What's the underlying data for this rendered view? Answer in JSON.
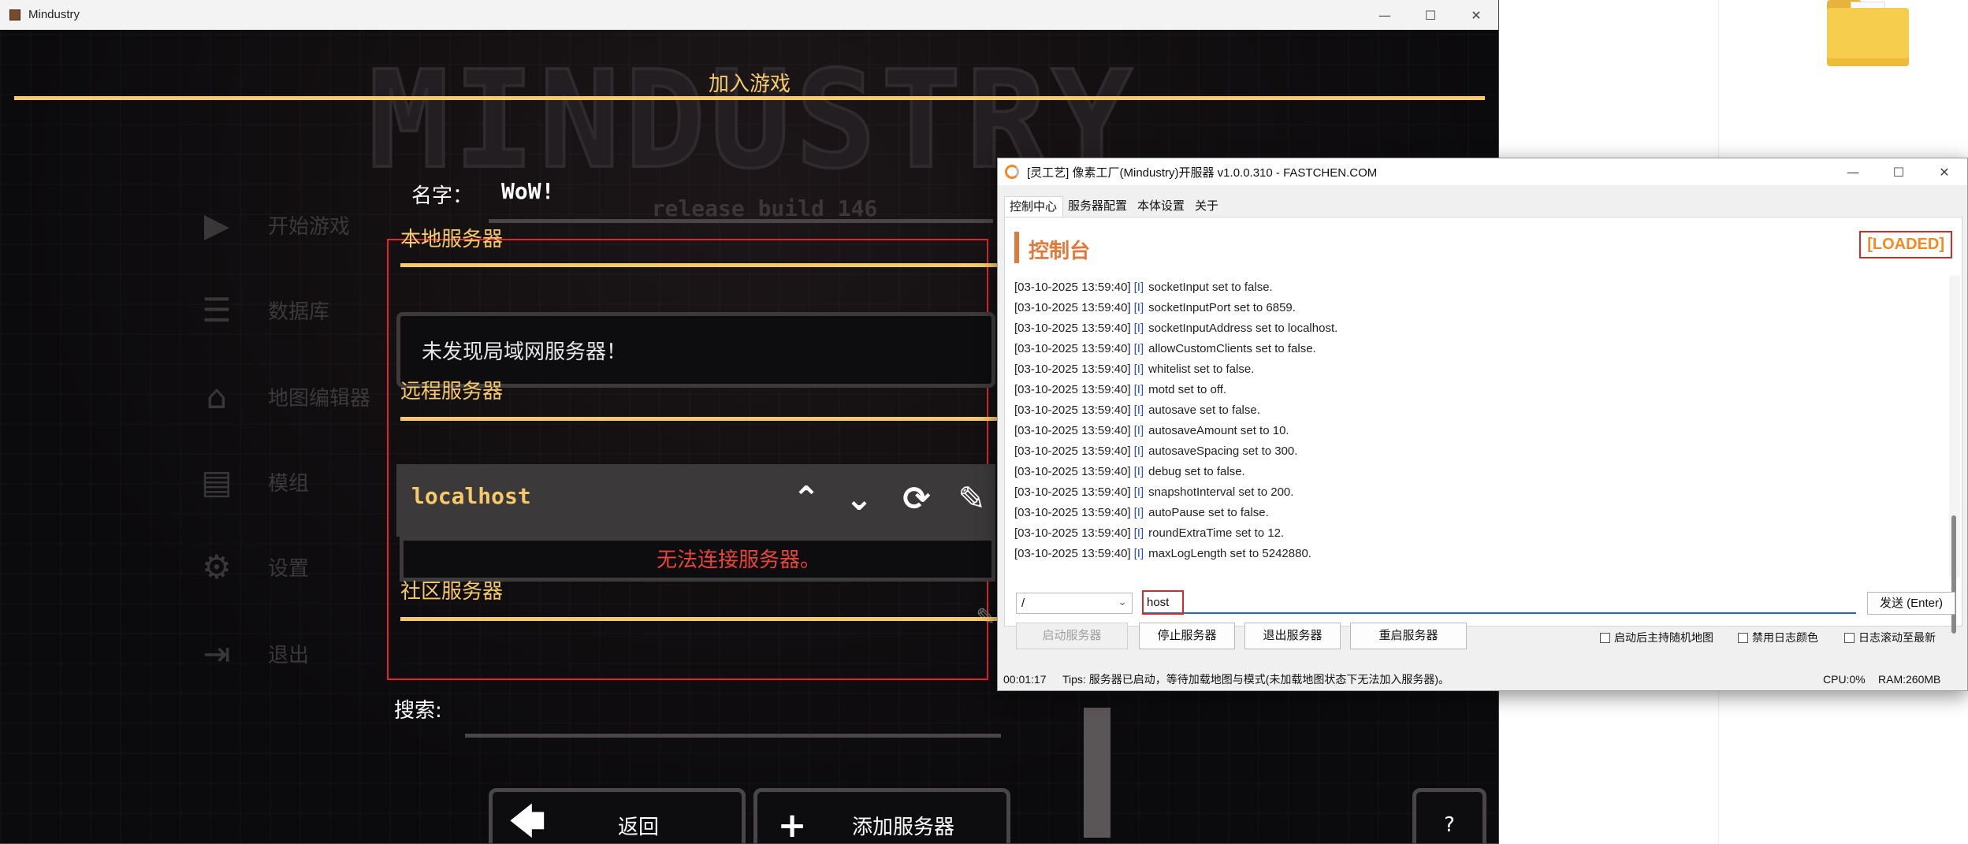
{
  "mindustry": {
    "window_title": "Mindustry",
    "logo_text": "MINDUSTRY",
    "build": "release build 146",
    "page_title": "加入游戏",
    "name_label": "名字：",
    "name_value": "WoW!",
    "menu": [
      "开始游戏",
      "数据库",
      "地图编辑器",
      "模组",
      "设置",
      "退出"
    ],
    "local_title": "本地服务器",
    "local_empty": "未发现局域网服务器！",
    "remote_title": "远程服务器",
    "server_name": "localhost",
    "server_error": "无法连接服务器。",
    "community_title": "社区服务器",
    "search_label": "搜索:",
    "back_label": "返回",
    "add_server_label": "添加服务器",
    "help_label": "?"
  },
  "console": {
    "window_title": "[灵工艺] 像素工厂(Mindustry)开服器 v1.0.0.310 - FASTCHEN.COM",
    "tabs": [
      "控制中心",
      "服务器配置",
      "本体设置",
      "关于"
    ],
    "header": "控制台",
    "status_badge": "[LOADED]",
    "log": [
      {
        "ts": "[03-10-2025 13:59:40]",
        "lv": "[I]",
        "msg": "socketInput set to false."
      },
      {
        "ts": "[03-10-2025 13:59:40]",
        "lv": "[I]",
        "msg": "socketInputPort set to 6859."
      },
      {
        "ts": "[03-10-2025 13:59:40]",
        "lv": "[I]",
        "msg": "socketInputAddress set to localhost."
      },
      {
        "ts": "[03-10-2025 13:59:40]",
        "lv": "[I]",
        "msg": "allowCustomClients set to false."
      },
      {
        "ts": "[03-10-2025 13:59:40]",
        "lv": "[I]",
        "msg": "whitelist set to false."
      },
      {
        "ts": "[03-10-2025 13:59:40]",
        "lv": "[I]",
        "msg": "motd set to off."
      },
      {
        "ts": "[03-10-2025 13:59:40]",
        "lv": "[I]",
        "msg": "autosave set to false."
      },
      {
        "ts": "[03-10-2025 13:59:40]",
        "lv": "[I]",
        "msg": "autosaveAmount set to 10."
      },
      {
        "ts": "[03-10-2025 13:59:40]",
        "lv": "[I]",
        "msg": "autosaveSpacing set to 300."
      },
      {
        "ts": "[03-10-2025 13:59:40]",
        "lv": "[I]",
        "msg": "debug set to false."
      },
      {
        "ts": "[03-10-2025 13:59:40]",
        "lv": "[I]",
        "msg": "snapshotInterval set to 200."
      },
      {
        "ts": "[03-10-2025 13:59:40]",
        "lv": "[I]",
        "msg": "autoPause set to false."
      },
      {
        "ts": "[03-10-2025 13:59:40]",
        "lv": "[I]",
        "msg": "roundExtraTime set to 12."
      },
      {
        "ts": "[03-10-2025 13:59:40]",
        "lv": "[I]",
        "msg": "maxLogLength set to 5242880."
      }
    ],
    "command_prefix": "/",
    "command_value": "host",
    "send_label": "发送 (Enter)",
    "start_label": "启动服务器",
    "stop_label": "停止服务器",
    "exit_label": "退出服务器",
    "restart_label": "重启服务器",
    "opt_random_map": "启动后主持随机地图",
    "opt_no_log_color": "禁用日志颜色",
    "opt_autoscroll": "日志滚动至最新",
    "status_time": "00:01:17",
    "status_tips": "Tips:  服务器已启动，等待加载地图与模式(未加载地图状态下无法加入服务器)。",
    "status_cpu": "CPU:0%",
    "status_ram": "RAM:260MB"
  }
}
